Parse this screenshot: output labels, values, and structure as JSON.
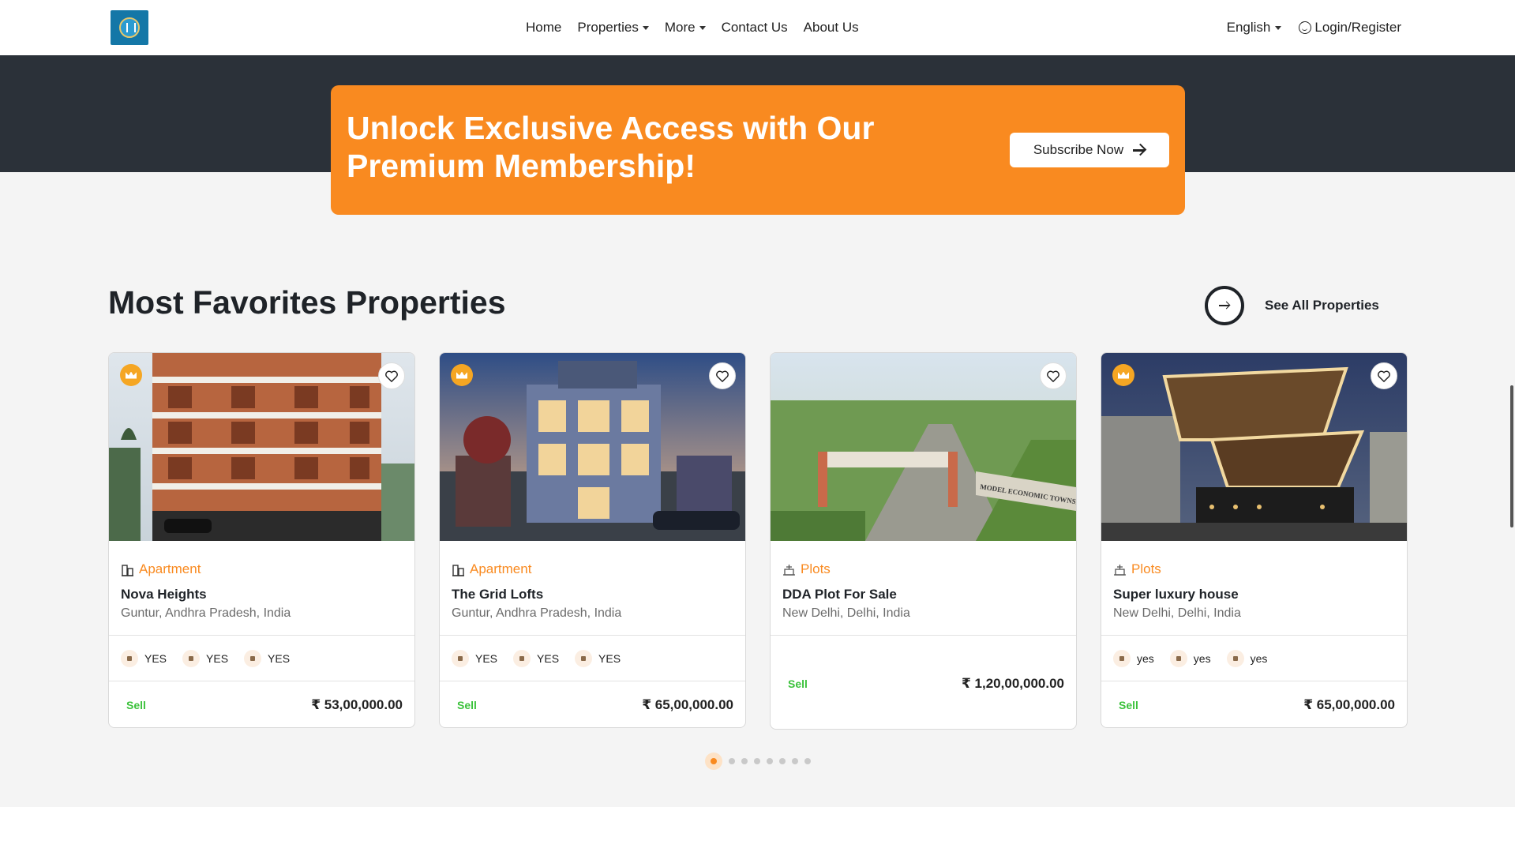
{
  "header": {
    "nav": [
      {
        "label": "Home",
        "dropdown": false
      },
      {
        "label": "Properties",
        "dropdown": true
      },
      {
        "label": "More",
        "dropdown": true
      },
      {
        "label": "Contact Us",
        "dropdown": false
      },
      {
        "label": "About Us",
        "dropdown": false
      }
    ],
    "language": "English",
    "login": "Login/Register"
  },
  "promo": {
    "text": "Unlock Exclusive Access with Our Premium Membership!",
    "button": "Subscribe Now"
  },
  "section": {
    "title": "Most Favorites Properties",
    "see_all": "See All Properties"
  },
  "cards": [
    {
      "category": "Apartment",
      "category_icon": "building-icon",
      "name": "Nova Heights",
      "location": "Guntur, Andhra Pradesh, India",
      "premium": true,
      "amenities": [
        "YES",
        "YES",
        "YES"
      ],
      "status": "Sell",
      "price": "₹ 53,00,000.00"
    },
    {
      "category": "Apartment",
      "category_icon": "building-icon",
      "name": "The Grid Lofts",
      "location": "Guntur, Andhra Pradesh, India",
      "premium": true,
      "amenities": [
        "YES",
        "YES",
        "YES"
      ],
      "status": "Sell",
      "price": "₹ 65,00,000.00"
    },
    {
      "category": "Plots",
      "category_icon": "plot-icon",
      "name": "DDA Plot For Sale",
      "location": "New Delhi, Delhi, India",
      "premium": false,
      "amenities": [],
      "status": "Sell",
      "price": "₹ 1,20,00,000.00",
      "image_sign": "MODEL ECONOMIC TOWNSH"
    },
    {
      "category": "Plots",
      "category_icon": "plot-icon",
      "name": "Super luxury house",
      "location": "New Delhi, Delhi, India",
      "premium": true,
      "amenities": [
        "yes",
        "yes",
        "yes"
      ],
      "status": "Sell",
      "price": "₹ 65,00,000.00"
    }
  ],
  "pagination": {
    "count": 8,
    "active": 1
  },
  "colors": {
    "accent": "#f98a20",
    "dark_band": "#2b3139",
    "sell_green": "#3cc23c",
    "crown": "#f5a623"
  }
}
